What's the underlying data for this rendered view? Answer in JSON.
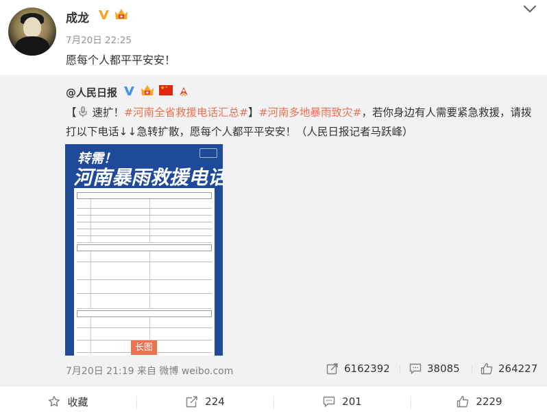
{
  "post": {
    "author": "成龙",
    "time": "7月20日 22:25",
    "text": "愿每个人都平平安安！"
  },
  "repost": {
    "author": "@人民日报",
    "text_parts": {
      "open": "【",
      "label1": " 速扩！",
      "tag1": "#河南全省救援电话汇总#",
      "mid": "】",
      "tag2": "#河南多地暴雨致灾#",
      "body": "，若你身边有人需要紧急救援，请拨打以下电话↓↓急转扩散，愿每个人都平平安安！（人民日报记者马跃峰）"
    },
    "image": {
      "top_text": "转需！",
      "title": "河南暴雨救援电话",
      "badge": "长图"
    },
    "time_source": "7月20日 21:19 来自 微博 weibo.com",
    "stats": {
      "forwards": "6162392",
      "comments": "38085",
      "likes": "264227"
    }
  },
  "actions": {
    "collect": "收藏",
    "forward": "224",
    "comment": "201",
    "like": "2229"
  },
  "colors": {
    "accent_orange": "#eb7350",
    "verified_blue": "#3f96e8",
    "repost_bg": "#f2f2f5",
    "image_blue": "#1f4a9a"
  },
  "icons": [
    "verified-v-icon",
    "vip-crown-icon",
    "chevron-down-icon",
    "china-flag-icon",
    "rocket-icon",
    "microphone-icon",
    "forward-icon",
    "comment-icon",
    "like-icon",
    "star-icon"
  ]
}
